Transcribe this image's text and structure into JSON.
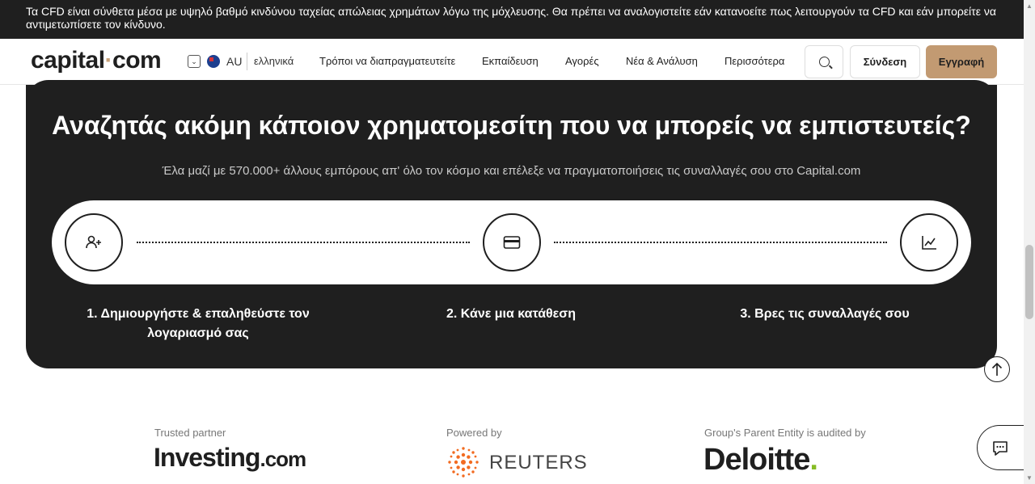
{
  "risk_warning": "Τα CFD είναι σύνθετα μέσα με υψηλό βαθμό κινδύνου ταχείας απώλειας χρημάτων λόγω της μόχλευσης. Θα πρέπει να αναλογιστείτε εάν κατανοείτε πως λειτουργούν τα CFD και εάν μπορείτε να αντιμετωπίσετε τον κίνδυνο.",
  "header": {
    "logo_main": "capital",
    "logo_dot": "·",
    "logo_tld": "com",
    "region": "AU",
    "language": "ελληνικά",
    "nav": [
      "Τρόποι να διαπραγματευτείτε",
      "Εκπαίδευση",
      "Αγορές",
      "Νέα & Ανάλυση",
      "Περισσότερα"
    ],
    "login_label": "Σύνδεση",
    "signup_label": "Εγγραφή"
  },
  "hero": {
    "title": "Αναζητάς ακόμη κάποιον χρηματομεσίτη που να μπορείς να εμπιστευτείς?",
    "subtitle": "Έλα μαζί με 570.000+ άλλους εμπόρους απ' όλο τον κόσμο και επέλεξε να πραγματοποιήσεις τις συναλλαγές σου στο Capital.com",
    "steps": [
      {
        "icon": "add-user-icon",
        "label_line1": "1. Δημιουργήστε & επαληθεύστε τον",
        "label_line2": "λογαριασμό σας"
      },
      {
        "icon": "credit-card-icon",
        "label_line1": "2. Κάνε μια κατάθεση",
        "label_line2": ""
      },
      {
        "icon": "chart-icon",
        "label_line1": "3. Βρες τις συναλλαγές σου",
        "label_line2": ""
      }
    ]
  },
  "partners": [
    {
      "caption": "Trusted partner",
      "name_main": "Investing",
      "name_tld": ".com"
    },
    {
      "caption": "Powered by",
      "name_main": "REUTERS"
    },
    {
      "caption": "Group's Parent Entity is audited by",
      "name_main": "Deloitte",
      "name_dot": "."
    }
  ]
}
